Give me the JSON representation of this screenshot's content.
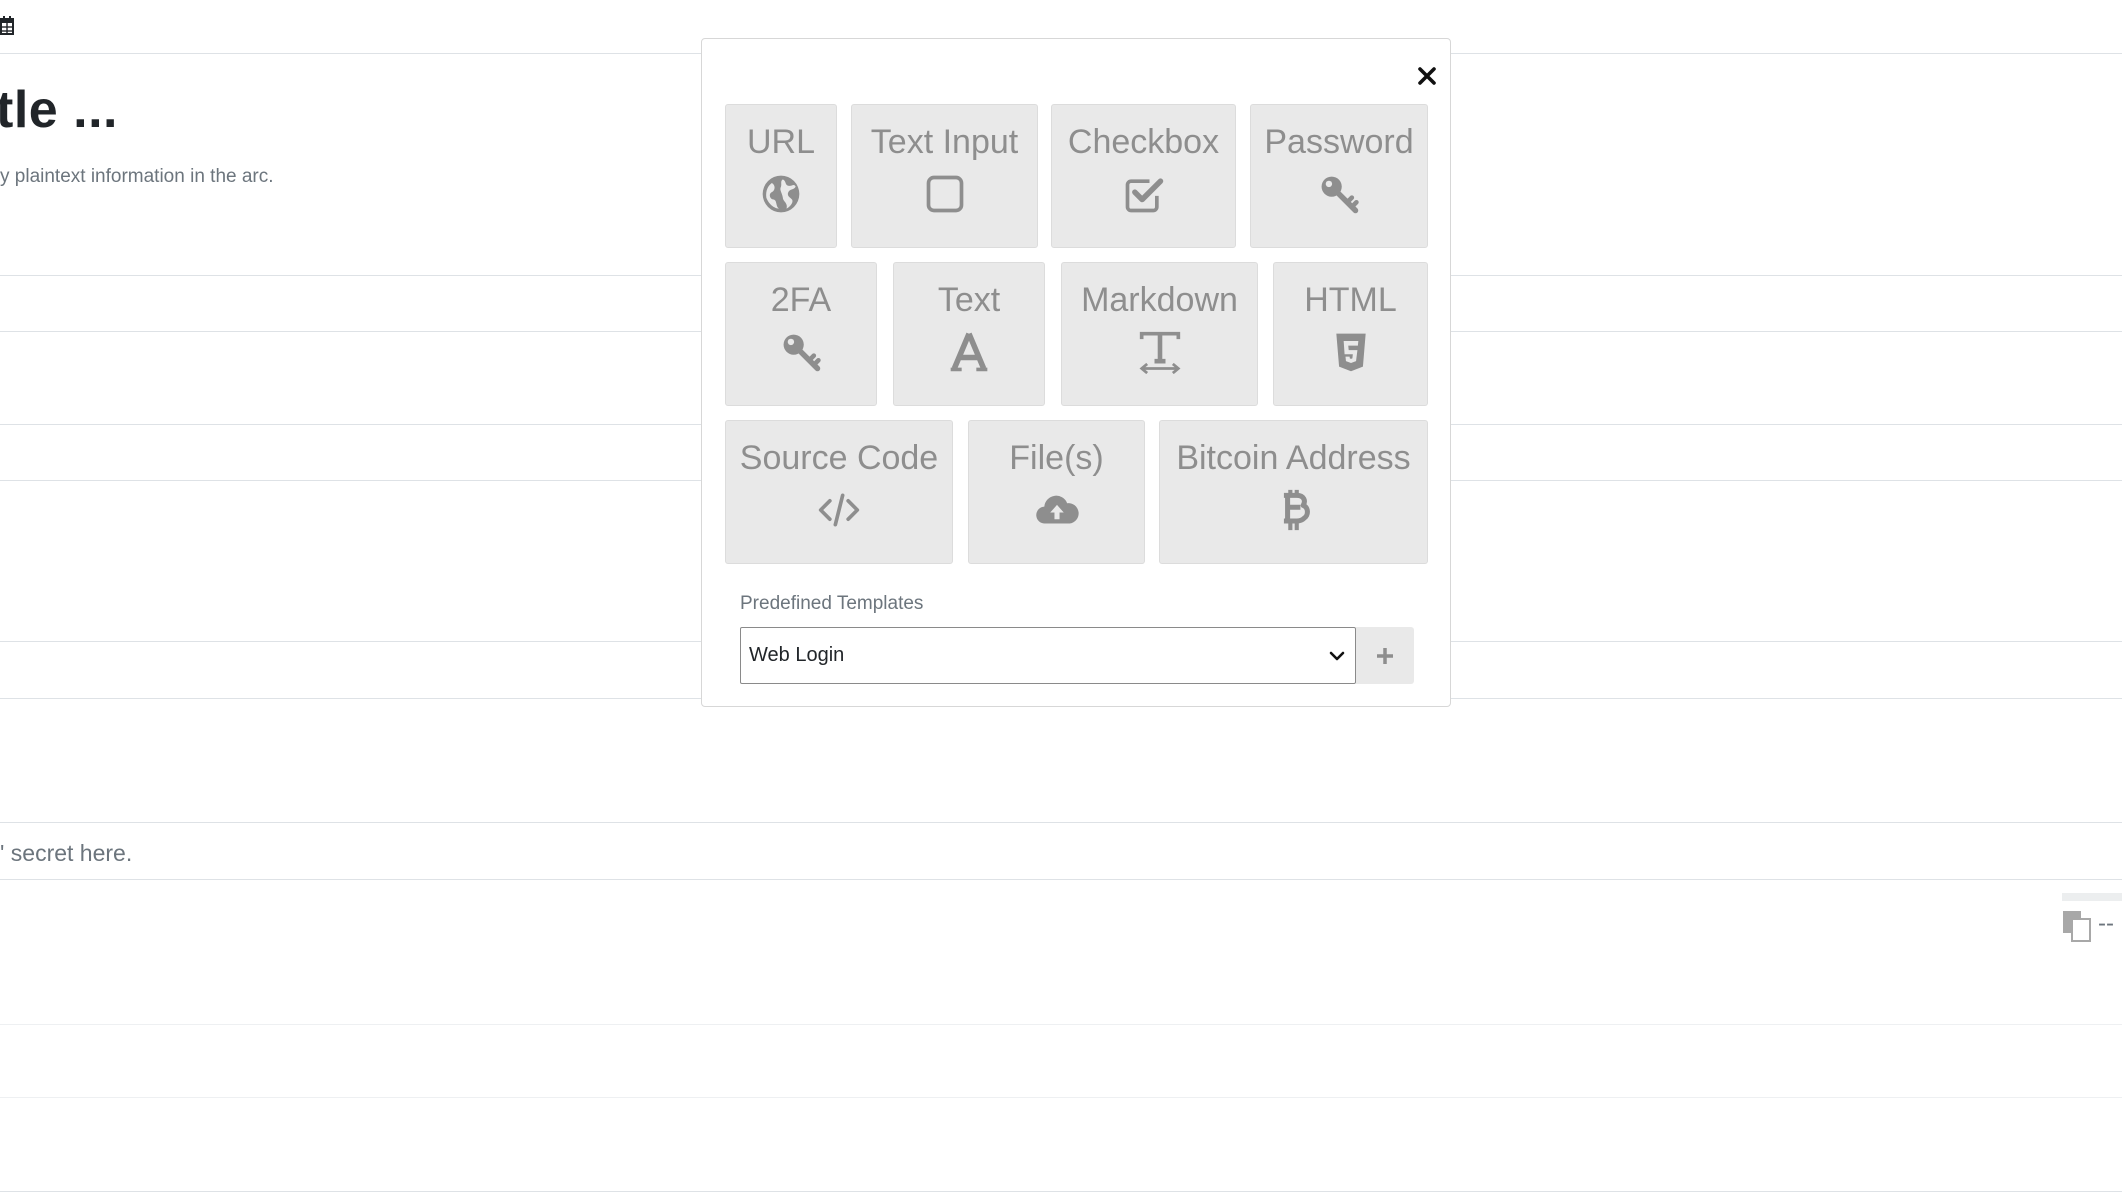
{
  "background": {
    "title": "tle ...",
    "subtitle": "y plaintext information in the arc.",
    "secret_placeholder": "' secret here.",
    "copy_text": "--"
  },
  "modal": {
    "tiles": [
      {
        "label": "URL",
        "icon": "globe-icon"
      },
      {
        "label": "Text Input",
        "icon": "square-icon"
      },
      {
        "label": "Checkbox",
        "icon": "checkbox-icon"
      },
      {
        "label": "Password",
        "icon": "key-icon"
      },
      {
        "label": "2FA",
        "icon": "key-icon"
      },
      {
        "label": "Text",
        "icon": "font-icon"
      },
      {
        "label": "Markdown",
        "icon": "text-width-icon"
      },
      {
        "label": "HTML",
        "icon": "html5-icon"
      },
      {
        "label": "Source Code",
        "icon": "code-icon"
      },
      {
        "label": "File(s)",
        "icon": "cloud-upload-icon"
      },
      {
        "label": "Bitcoin Address",
        "icon": "bitcoin-icon"
      }
    ],
    "templates": {
      "label": "Predefined Templates",
      "selected": "Web Login"
    }
  },
  "colors": {
    "tile_bg": "#e9e9e9",
    "tile_fg": "#8e8e8e",
    "muted_text": "#6c757d"
  }
}
